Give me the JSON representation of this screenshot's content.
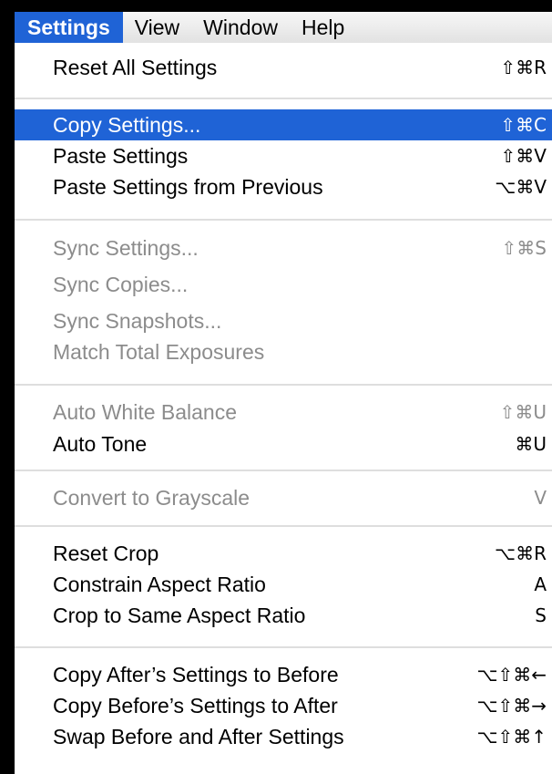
{
  "menubar": {
    "items": [
      "Settings",
      "View",
      "Window",
      "Help"
    ]
  },
  "menu": {
    "items": [
      {
        "label": "Reset All Settings",
        "shortcut": "⇧⌘R"
      },
      {
        "label": "Copy Settings...",
        "shortcut": "⇧⌘C"
      },
      {
        "label": "Paste Settings",
        "shortcut": "⇧⌘V"
      },
      {
        "label": "Paste Settings from Previous",
        "shortcut": "⌥⌘V"
      },
      {
        "label": "Sync Settings...",
        "shortcut": "⇧⌘S"
      },
      {
        "label": "Sync Copies...",
        "shortcut": ""
      },
      {
        "label": "Sync Snapshots...",
        "shortcut": ""
      },
      {
        "label": "Match Total Exposures",
        "shortcut": ""
      },
      {
        "label": "Auto White Balance",
        "shortcut": "⇧⌘U"
      },
      {
        "label": "Auto Tone",
        "shortcut": "⌘U"
      },
      {
        "label": "Convert to Grayscale",
        "shortcut": "V"
      },
      {
        "label": "Reset Crop",
        "shortcut": "⌥⌘R"
      },
      {
        "label": "Constrain Aspect Ratio",
        "shortcut": "A"
      },
      {
        "label": "Crop to Same Aspect Ratio",
        "shortcut": "S"
      },
      {
        "label": "Copy After’s Settings to Before",
        "shortcut": "⌥⇧⌘←"
      },
      {
        "label": "Copy Before’s Settings to After",
        "shortcut": "⌥⇧⌘→"
      },
      {
        "label": "Swap Before and After Settings",
        "shortcut": "⌥⇧⌘↑"
      }
    ],
    "highlighted_item": "Copy Settings...",
    "disabled_items": [
      "Sync Settings...",
      "Sync Copies...",
      "Sync Snapshots...",
      "Match Total Exposures",
      "Auto White Balance",
      "Convert to Grayscale"
    ]
  },
  "colors": {
    "highlight": "#1f63d6",
    "disabled_text": "#8c8c8c",
    "separator": "#dedede"
  }
}
